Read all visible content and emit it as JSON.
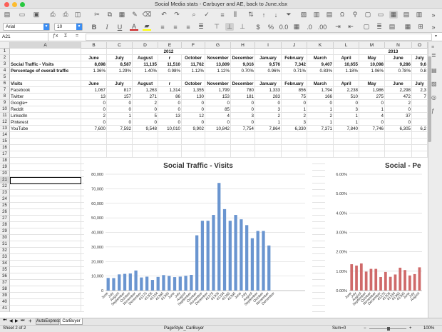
{
  "window": {
    "title": "Social Media stats - Carbuyer and AE, back to June.xlsx"
  },
  "toolbar": {
    "font_name": "Arial",
    "font_size": "10",
    "bold": "B",
    "italic": "I",
    "underline": "U",
    "special_char": "Ω"
  },
  "formula_bar": {
    "cell_ref": "A21",
    "fx": "ƒx",
    "sum": "Σ",
    "eq": "=",
    "content": ""
  },
  "columns": [
    "A",
    "B",
    "C",
    "D",
    "E",
    "F",
    "G",
    "H",
    "I",
    "J",
    "K",
    "L",
    "M",
    "N",
    "O"
  ],
  "rows": [
    "1",
    "2",
    "3",
    "4",
    "5",
    "6",
    "7",
    "8",
    "9",
    "10",
    "11",
    "12",
    "13",
    "14",
    "15",
    "16",
    "17",
    "18",
    "19",
    "20",
    "21",
    "22",
    "23",
    "24",
    "25",
    "26",
    "27",
    "28",
    "29",
    "30",
    "31",
    "32",
    "33",
    "34",
    "35",
    "36",
    "37",
    "38",
    "39",
    "40",
    "41"
  ],
  "sheet": {
    "year_2012": "2012",
    "year_2013": "2013",
    "months_row": [
      "June",
      "July",
      "August",
      "r",
      "October",
      "November",
      "December",
      "January",
      "February",
      "March",
      "April",
      "May",
      "June",
      "July"
    ],
    "r3": {
      "label": "Social Traffic - Visits",
      "values": [
        "8,698",
        "8,587",
        "11,135",
        "11,510",
        "11,762",
        "13,809",
        "9,016",
        "9,576",
        "7,342",
        "9,407",
        "10,655",
        "10,098",
        "9,286",
        "9,6"
      ]
    },
    "r4": {
      "label": "Percentage of overall traffic",
      "values": [
        "1.36%",
        "1.29%",
        "1.40%",
        "0.98%",
        "1.12%",
        "1.12%",
        "0.70%",
        "0.96%",
        "0.71%",
        "0.83%",
        "1.18%",
        "1.06%",
        "0.78%",
        "0.8"
      ]
    },
    "r6": {
      "label": "Visits",
      "values": [
        "June",
        "July",
        "August",
        "r",
        "October",
        "November",
        "December",
        "January",
        "February",
        "March",
        "April",
        "May",
        "June",
        "July"
      ]
    },
    "data_rows": [
      {
        "label": "Facebook",
        "values": [
          "1,067",
          "817",
          "1,263",
          "1,314",
          "1,355",
          "1,799",
          "780",
          "1,333",
          "856",
          "1,794",
          "2,238",
          "1,986",
          "2,298",
          "2,3"
        ]
      },
      {
        "label": "Twitter",
        "values": [
          "13",
          "157",
          "271",
          "86",
          "130",
          "153",
          "181",
          "283",
          "75",
          "166",
          "510",
          "275",
          "472",
          "7"
        ]
      },
      {
        "label": "Google+",
        "values": [
          "0",
          "0",
          "2",
          "0",
          "0",
          "0",
          "0",
          "0",
          "0",
          "0",
          "0",
          "0",
          "2",
          ""
        ]
      },
      {
        "label": "Reddit",
        "values": [
          "0",
          "0",
          "0",
          "0",
          "0",
          "85",
          "0",
          "3",
          "1",
          "1",
          "3",
          "1",
          "0",
          ""
        ]
      },
      {
        "label": "LinkedIn",
        "values": [
          "2",
          "1",
          "5",
          "13",
          "12",
          "4",
          "3",
          "2",
          "2",
          "2",
          "1",
          "4",
          "37",
          ""
        ]
      },
      {
        "label": "Pinterest",
        "values": [
          "0",
          "0",
          "0",
          "0",
          "0",
          "0",
          "0",
          "1",
          "3",
          "1",
          "1",
          "0",
          "0",
          ""
        ]
      },
      {
        "label": "YouTube",
        "values": [
          "7,600",
          "7,592",
          "9,548",
          "10,010",
          "9,902",
          "10,842",
          "7,754",
          "7,864",
          "6,330",
          "7,371",
          "7,840",
          "7,746",
          "6,305",
          "6,2"
        ]
      }
    ]
  },
  "chart_data": [
    {
      "type": "bar",
      "title": "Social Traffic - Visits",
      "ylim": [
        0,
        80000
      ],
      "yticks": [
        "0",
        "10,000",
        "20,000",
        "30,000",
        "40,000",
        "50,000",
        "60,000",
        "70,000",
        "80,000"
      ],
      "categories": [
        "June",
        "July",
        "August",
        "September",
        "October",
        "November",
        "December",
        "41275",
        "41306",
        "41334",
        "41365",
        "41395",
        "June",
        "July",
        "August",
        "September",
        "October",
        "November",
        "December",
        "41275",
        "41306",
        "41334",
        "41365",
        "41395",
        "June",
        "July",
        "August",
        "September",
        "October",
        "November",
        "December",
        "",
        "",
        "",
        "",
        ""
      ],
      "values": [
        8698,
        8587,
        11135,
        11510,
        11762,
        13809,
        9016,
        9576,
        7342,
        9407,
        10655,
        10098,
        9286,
        9600,
        10200,
        10800,
        38000,
        48000,
        48000,
        52000,
        74000,
        56000,
        48000,
        52000,
        49000,
        45000,
        36000,
        41000,
        41000,
        31000,
        0,
        0,
        0,
        0,
        0,
        0
      ],
      "color": "#6a95d0",
      "grid": true
    },
    {
      "type": "bar",
      "title": "Social - Pe",
      "ylim": [
        0,
        0.06
      ],
      "yticks": [
        "0.00%",
        "1.00%",
        "2.00%",
        "3.00%",
        "4.00%",
        "5.00%",
        "6.00%"
      ],
      "categories": [
        "June",
        "July",
        "August",
        "September",
        "October",
        "November",
        "December",
        "41275",
        "41306",
        "41334",
        "41365",
        "41395",
        "June",
        "July",
        "August"
      ],
      "values": [
        0.0136,
        0.0129,
        0.014,
        0.0098,
        0.0112,
        0.0112,
        0.007,
        0.0096,
        0.0071,
        0.0083,
        0.0118,
        0.0106,
        0.0078,
        0.0085,
        0.012
      ],
      "color": "#cf6a6a",
      "grid": true
    }
  ],
  "tabs": {
    "nav_first": "⏮",
    "nav_prev": "◀",
    "nav_next": "▶",
    "nav_last": "⏭",
    "add": "+",
    "items": [
      "AutoExpress",
      "CarBuyer"
    ]
  },
  "status": {
    "sheet_pos": "Sheet 2 of 2",
    "page_style": "PageStyle_CarBuyer",
    "sum": "Sum=0",
    "zoom": "100%",
    "zoom_minus": "−",
    "zoom_plus": "+"
  }
}
